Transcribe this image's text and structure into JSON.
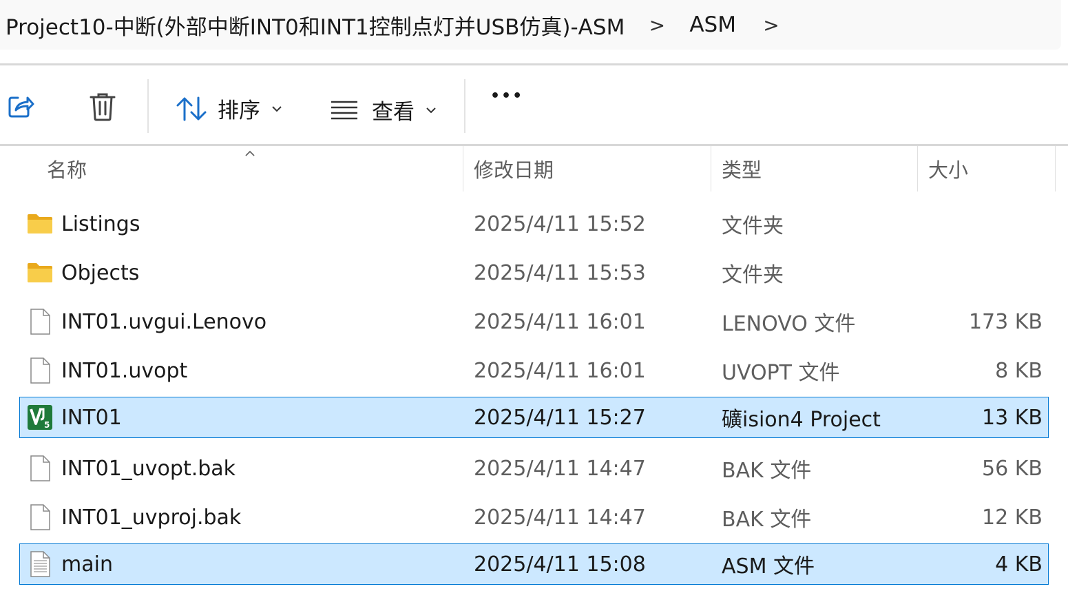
{
  "breadcrumb": {
    "folder": "Project10-中断(外部中断INT0和INT1控制点灯并USB仿真)-ASM",
    "subfolder": "ASM",
    "separator": ">"
  },
  "toolbar": {
    "sort_label": "排序",
    "view_label": "查看",
    "more_label": "•••"
  },
  "columns": {
    "name": "名称",
    "date": "修改日期",
    "type": "类型",
    "size": "大小"
  },
  "files": [
    {
      "name": "Listings",
      "date": "2025/4/11 15:52",
      "type": "文件夹",
      "size": "",
      "icon": "folder-icon",
      "selected": false
    },
    {
      "name": "Objects",
      "date": "2025/4/11 15:53",
      "type": "文件夹",
      "size": "",
      "icon": "folder-icon",
      "selected": false
    },
    {
      "name": "INT01.uvgui.Lenovo",
      "date": "2025/4/11 16:01",
      "type": "LENOVO 文件",
      "size": "173 KB",
      "icon": "file-icon",
      "selected": false
    },
    {
      "name": "INT01.uvopt",
      "date": "2025/4/11 16:01",
      "type": "UVOPT 文件",
      "size": "8 KB",
      "icon": "file-icon",
      "selected": false
    },
    {
      "name": "INT01",
      "date": "2025/4/11 15:27",
      "type": "礦ision4 Project",
      "size": "13 KB",
      "icon": "uvision-project-icon",
      "selected": true
    },
    {
      "name": "INT01_uvopt.bak",
      "date": "2025/4/11 14:47",
      "type": "BAK 文件",
      "size": "56 KB",
      "icon": "file-icon",
      "selected": false
    },
    {
      "name": "INT01_uvproj.bak",
      "date": "2025/4/11 14:47",
      "type": "BAK 文件",
      "size": "12 KB",
      "icon": "file-icon",
      "selected": false
    },
    {
      "name": "main",
      "date": "2025/4/11 15:08",
      "type": "ASM 文件",
      "size": "4 KB",
      "icon": "text-file-icon",
      "selected": true
    }
  ],
  "colors": {
    "selection_bg": "#cce8ff",
    "selection_border": "#0078d4",
    "folder": "#f5c440",
    "uvision": "#1f7a3a"
  }
}
